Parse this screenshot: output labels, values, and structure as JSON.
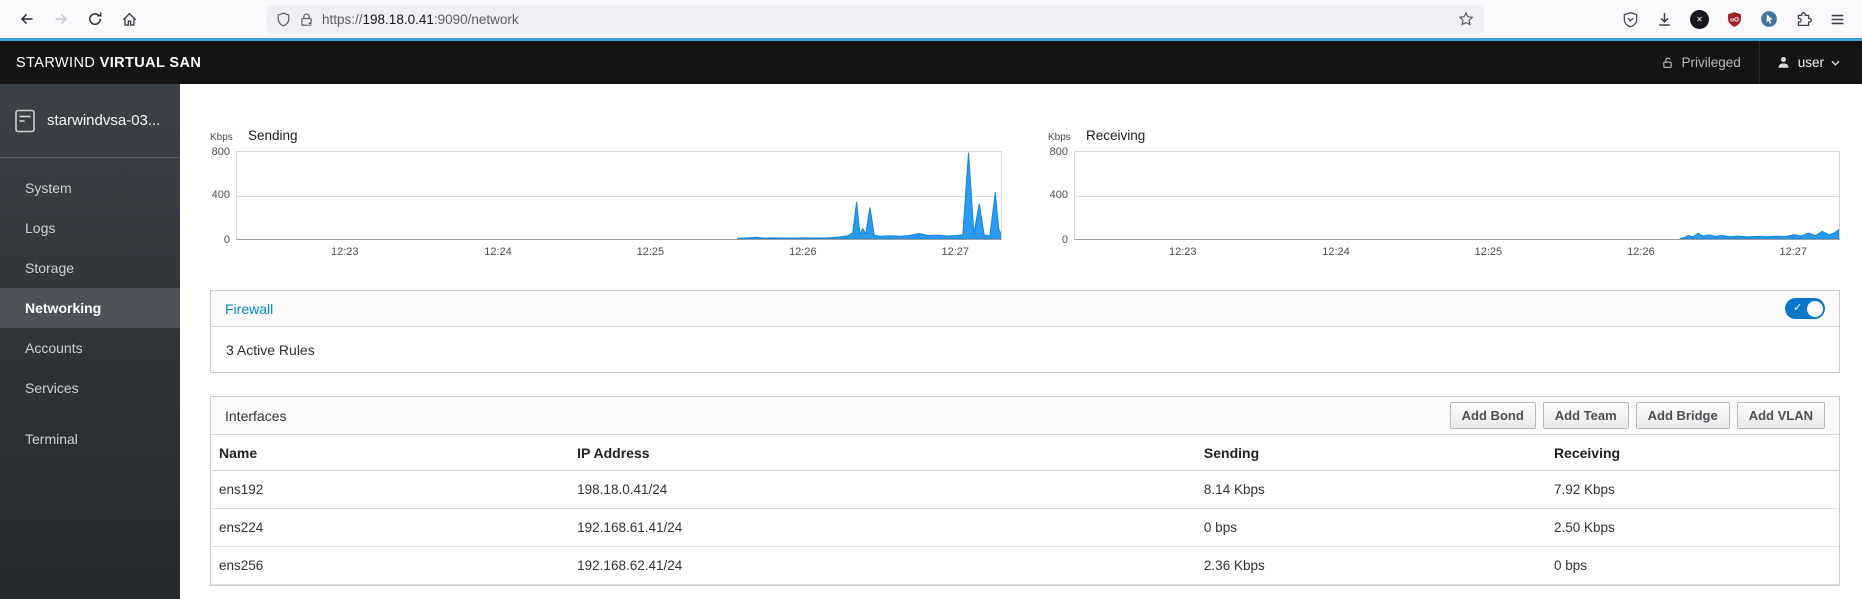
{
  "browser": {
    "url_prefix": "https://",
    "url_host": "198.18.0.41",
    "url_suffix": ":9090/network"
  },
  "masthead": {
    "brand_prefix": "STARWIND ",
    "brand_suffix": "VIRTUAL SAN",
    "privileged_label": "Privileged",
    "user_label": "user"
  },
  "sidebar": {
    "host": "starwindvsa-03...",
    "items": [
      {
        "label": "System",
        "active": false,
        "gap_before": false
      },
      {
        "label": "Logs",
        "active": false,
        "gap_before": false
      },
      {
        "label": "Storage",
        "active": false,
        "gap_before": false
      },
      {
        "label": "Networking",
        "active": true,
        "gap_before": false
      },
      {
        "label": "Accounts",
        "active": false,
        "gap_before": false
      },
      {
        "label": "Services",
        "active": false,
        "gap_before": false
      },
      {
        "label": "Terminal",
        "active": false,
        "gap_before": true
      }
    ]
  },
  "chart_data": [
    {
      "type": "area",
      "title": "Sending",
      "ylabel": "Kbps",
      "ylim": [
        0,
        800
      ],
      "yticks": [
        "800",
        "400",
        "0"
      ],
      "xticks": [
        "12:23",
        "12:24",
        "12:25",
        "12:26",
        "12:27"
      ],
      "xtick_positions": [
        0.142,
        0.342,
        0.541,
        0.74,
        0.939
      ],
      "grid": "horizontal-midline",
      "legend": "none",
      "series": [
        {
          "name": "sending-kbps",
          "color": "#2b9af3",
          "stroke": "#1287d8",
          "points": [
            [
              0.655,
              3
            ],
            [
              0.66,
              8
            ],
            [
              0.67,
              10
            ],
            [
              0.68,
              16
            ],
            [
              0.69,
              8
            ],
            [
              0.7,
              10
            ],
            [
              0.72,
              8
            ],
            [
              0.74,
              10
            ],
            [
              0.76,
              9
            ],
            [
              0.775,
              12
            ],
            [
              0.788,
              18
            ],
            [
              0.8,
              30
            ],
            [
              0.806,
              60
            ],
            [
              0.811,
              340
            ],
            [
              0.8155,
              40
            ],
            [
              0.819,
              95
            ],
            [
              0.823,
              50
            ],
            [
              0.8285,
              290
            ],
            [
              0.834,
              35
            ],
            [
              0.842,
              25
            ],
            [
              0.855,
              30
            ],
            [
              0.868,
              25
            ],
            [
              0.88,
              32
            ],
            [
              0.893,
              50
            ],
            [
              0.905,
              32
            ],
            [
              0.918,
              36
            ],
            [
              0.93,
              28
            ],
            [
              0.942,
              32
            ],
            [
              0.95,
              38
            ],
            [
              0.9575,
              795
            ],
            [
              0.9645,
              45
            ],
            [
              0.9715,
              325
            ],
            [
              0.978,
              38
            ],
            [
              0.9855,
              30
            ],
            [
              0.9925,
              430
            ],
            [
              0.997,
              95
            ],
            [
              1,
              45
            ]
          ]
        }
      ]
    },
    {
      "type": "area",
      "title": "Receiving",
      "ylabel": "Kbps",
      "ylim": [
        0,
        800
      ],
      "yticks": [
        "800",
        "400",
        "0"
      ],
      "xticks": [
        "12:23",
        "12:24",
        "12:25",
        "12:26",
        "12:27"
      ],
      "xtick_positions": [
        0.142,
        0.342,
        0.541,
        0.74,
        0.939
      ],
      "grid": "horizontal-midline",
      "legend": "none",
      "series": [
        {
          "name": "receiving-kbps",
          "color": "#2b9af3",
          "stroke": "#1287d8",
          "points": [
            [
              0.792,
              2
            ],
            [
              0.797,
              14
            ],
            [
              0.803,
              32
            ],
            [
              0.809,
              20
            ],
            [
              0.8155,
              52
            ],
            [
              0.822,
              26
            ],
            [
              0.83,
              38
            ],
            [
              0.838,
              24
            ],
            [
              0.847,
              32
            ],
            [
              0.857,
              22
            ],
            [
              0.868,
              26
            ],
            [
              0.88,
              20
            ],
            [
              0.893,
              24
            ],
            [
              0.906,
              21
            ],
            [
              0.919,
              25
            ],
            [
              0.931,
              23
            ],
            [
              0.941,
              40
            ],
            [
              0.95,
              26
            ],
            [
              0.96,
              55
            ],
            [
              0.969,
              30
            ],
            [
              0.978,
              70
            ],
            [
              0.987,
              38
            ],
            [
              0.995,
              60
            ],
            [
              1,
              88
            ]
          ]
        }
      ]
    }
  ],
  "firewall": {
    "title": "Firewall",
    "status": "3 Active Rules",
    "toggle_on": true,
    "toggle_check": "✓"
  },
  "interfaces": {
    "title": "Interfaces",
    "buttons": [
      "Add Bond",
      "Add Team",
      "Add Bridge",
      "Add VLAN"
    ],
    "columns": [
      "Name",
      "IP Address",
      "Sending",
      "Receiving"
    ],
    "column_widths": [
      "22%",
      "38.5%",
      "21.5%",
      "18%"
    ],
    "rows": [
      [
        "ens192",
        "198.18.0.41/24",
        "8.14 Kbps",
        "7.92 Kbps"
      ],
      [
        "ens224",
        "192.168.61.41/24",
        "0 bps",
        "2.50 Kbps"
      ],
      [
        "ens256",
        "192.168.62.41/24",
        "2.36 Kbps",
        "0 bps"
      ]
    ]
  },
  "colors": {
    "accent_line": "#3da0da",
    "chart_fill": "#2b9af3",
    "link_blue": "#0088ce",
    "toggle_blue": "#0877c9",
    "masthead_bg": "#141414"
  }
}
